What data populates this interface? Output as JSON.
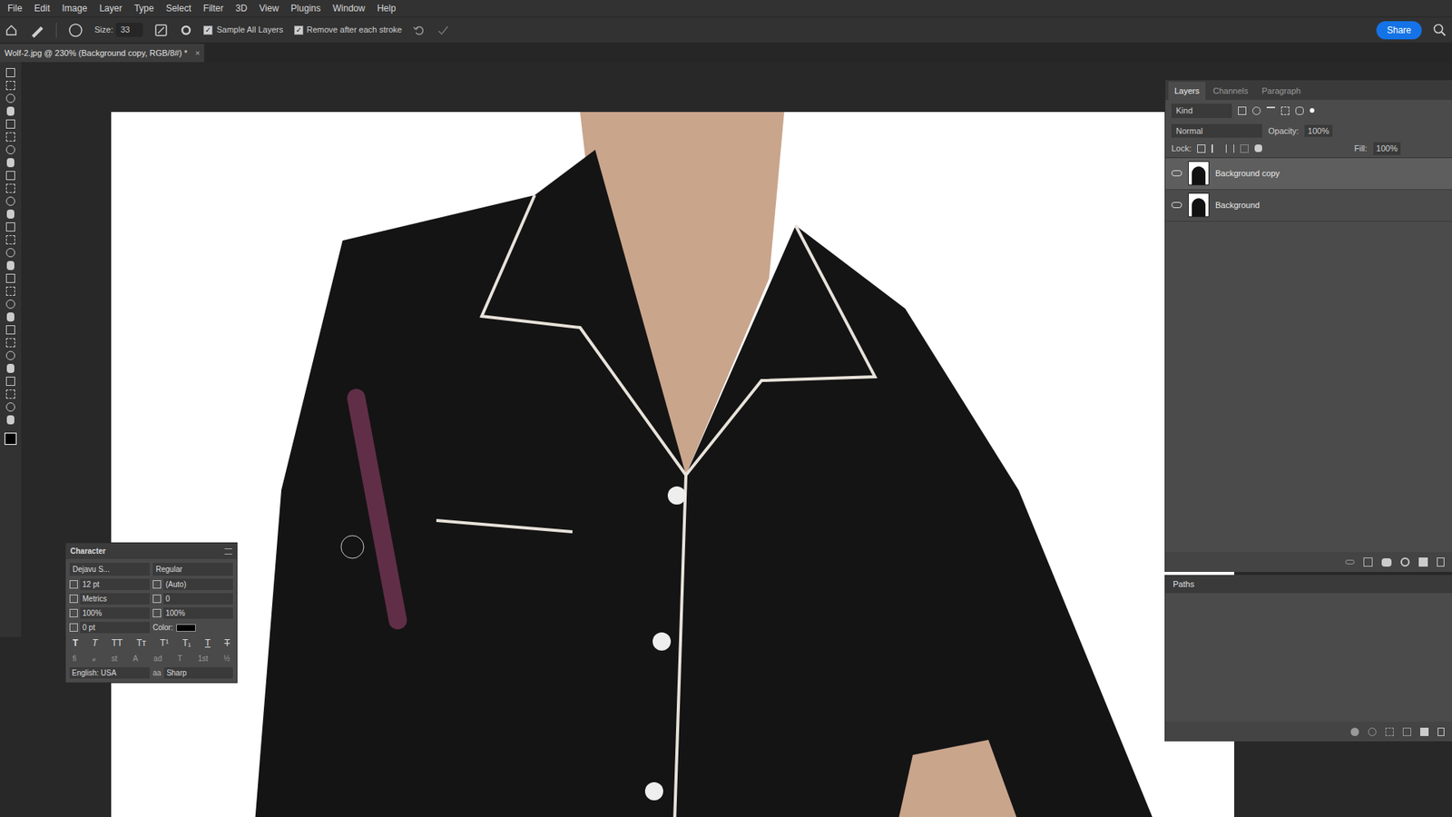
{
  "menu": [
    "File",
    "Edit",
    "Image",
    "Layer",
    "Type",
    "Select",
    "Filter",
    "3D",
    "View",
    "Plugins",
    "Window",
    "Help"
  ],
  "options_bar": {
    "size_label": "Size:",
    "size": "33",
    "sample_all_layers": {
      "label": "Sample All Layers",
      "checked": true
    },
    "remove_after": {
      "label": "Remove after each stroke",
      "checked": true
    },
    "share": "Share"
  },
  "document_tab": {
    "title": "Wolf-2.jpg @ 230% (Background copy, RGB/8#) *",
    "close": "×"
  },
  "layers_panel": {
    "tabs": [
      {
        "label": "Layers",
        "selected": true
      },
      {
        "label": "Channels",
        "selected": false
      },
      {
        "label": "Paragraph",
        "selected": false
      }
    ],
    "filter": "Kind",
    "blend_mode": "Normal",
    "opacity_label": "Opacity:",
    "opacity": "100%",
    "lock_label": "Lock:",
    "fill_label": "Fill:",
    "fill": "100%",
    "layers": [
      {
        "name": "Background copy",
        "visible": true,
        "selected": true
      },
      {
        "name": "Background",
        "visible": true,
        "selected": false
      }
    ]
  },
  "paths_panel": {
    "title": "Paths"
  },
  "character_panel": {
    "title": "Character",
    "font": "Dejavu S...",
    "style": "Regular",
    "size": "12 pt",
    "leading": "(Auto)",
    "kerning": "Metrics",
    "tracking": "0",
    "vertical_scale": "100%",
    "horizontal_scale": "100%",
    "baseline": "0 pt",
    "color_label": "Color:",
    "style_buttons": [
      {
        "label": "T",
        "kind": "bold"
      },
      {
        "label": "T",
        "kind": "italic"
      },
      {
        "label": "TT",
        "kind": "caps"
      },
      {
        "label": "Tт",
        "kind": "smallcaps"
      },
      {
        "label": "T¹",
        "kind": "super"
      },
      {
        "label": "T₁",
        "kind": "sub"
      },
      {
        "label": "T",
        "kind": "underline"
      },
      {
        "label": "T",
        "kind": "strike"
      }
    ],
    "opentype_buttons": [
      "fi",
      "ℴ",
      "st",
      "A",
      "ad",
      "T",
      "1st",
      "½"
    ],
    "language": "English: USA",
    "antialias_icon": "aa",
    "antialias": "Sharp"
  }
}
